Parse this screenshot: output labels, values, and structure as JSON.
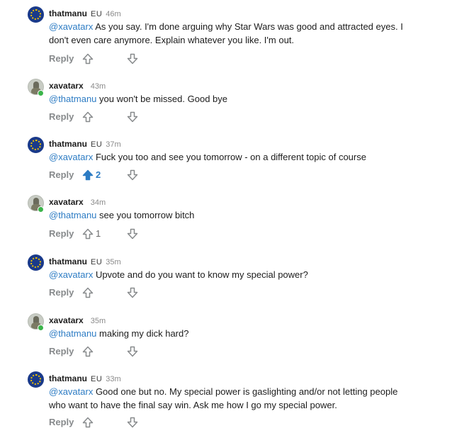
{
  "colors": {
    "mention": "#2d7cc4",
    "upvote_active": "#2d7cc4",
    "action_gray": "#878a8c",
    "online": "#3bb44a"
  },
  "comments": [
    {
      "username": "thatmanu",
      "flair": "EU",
      "time": "46m",
      "mention": "@xavatarx",
      "text": " As you say. I'm done arguing why Star Wars was good and attracted eyes. I don't even care anymore. Explain whatever you like. I'm out.",
      "reply_label": "Reply",
      "score": "",
      "upvoted": false,
      "avatar": "eu-flag-avatar"
    },
    {
      "username": "xavatarx",
      "flair": "",
      "time": "43m",
      "mention": "@thatmanu",
      "text": " you won't be missed. Good bye",
      "reply_label": "Reply",
      "score": "",
      "upvoted": false,
      "avatar": "photo-avatar"
    },
    {
      "username": "thatmanu",
      "flair": "EU",
      "time": "37m",
      "mention": "@xavatarx",
      "text": " Fuck you too and see you tomorrow - on a different topic of course",
      "reply_label": "Reply",
      "score": "2",
      "upvoted": true,
      "avatar": "eu-flag-avatar"
    },
    {
      "username": "xavatarx",
      "flair": "",
      "time": "34m",
      "mention": "@thatmanu",
      "text": " see you tomorrow bitch",
      "reply_label": "Reply",
      "score": "1",
      "upvoted": false,
      "avatar": "photo-avatar"
    },
    {
      "username": "thatmanu",
      "flair": "EU",
      "time": "35m",
      "mention": "@xavatarx",
      "text": " Upvote and do you want to know my special power?",
      "reply_label": "Reply",
      "score": "",
      "upvoted": false,
      "avatar": "eu-flag-avatar"
    },
    {
      "username": "xavatarx",
      "flair": "",
      "time": "35m",
      "mention": "@thatmanu",
      "text": " making my dick hard?",
      "reply_label": "Reply",
      "score": "",
      "upvoted": false,
      "avatar": "photo-avatar"
    },
    {
      "username": "thatmanu",
      "flair": "EU",
      "time": "33m",
      "mention": "@xavatarx",
      "text": " Good one but no. My special power is gaslighting and/or not letting people who want to have the final say win. Ask me how I go my special power.",
      "reply_label": "Reply",
      "score": "",
      "upvoted": false,
      "avatar": "eu-flag-avatar"
    }
  ]
}
